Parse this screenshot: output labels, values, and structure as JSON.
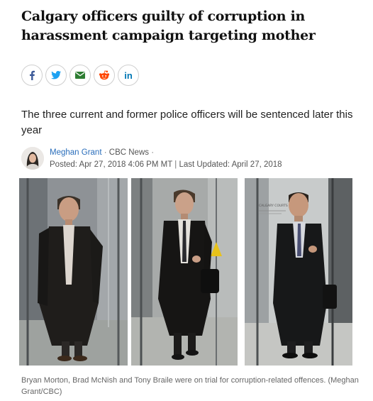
{
  "article": {
    "headline": "Calgary officers guilty of corruption in harassment campaign targeting mother",
    "deck": "The three current and former police officers will be sentenced later this year",
    "author": "Meghan Grant",
    "outlet": "CBC News",
    "posted": "Posted: Apr 27, 2018 4:06 PM MT",
    "updated": "Last Updated: April 27, 2018",
    "caption": "Bryan Morton, Brad McNish and Tony Braile were on trial for corruption-related offences. (Meghan Grant/CBC)"
  },
  "share": {
    "buttons": [
      {
        "icon": "facebook-icon",
        "color": "#3b5998"
      },
      {
        "icon": "twitter-icon",
        "color": "#1da1f2"
      },
      {
        "icon": "email-icon",
        "color": "#2e7d32"
      },
      {
        "icon": "reddit-icon",
        "color": "#ff4500"
      },
      {
        "icon": "linkedin-icon",
        "color": "#0077b5",
        "label": "in"
      }
    ]
  },
  "separators": {
    "dot": "·",
    "pipe": "|"
  },
  "photo_text": {
    "sign": "CALGARY COURTS CENTRE"
  }
}
